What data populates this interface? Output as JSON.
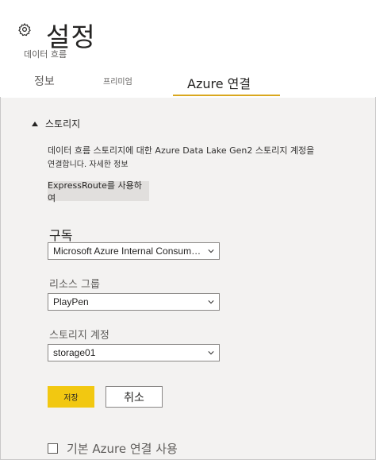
{
  "header": {
    "title": "설정",
    "subtitle": "데이터 흐름",
    "icon": "gear-icon"
  },
  "tabs": [
    {
      "label": "정보"
    },
    {
      "label": "프리미엄"
    },
    {
      "label": "Azure 연결",
      "selected": true
    }
  ],
  "accent_color": "#F2C811",
  "storage": {
    "section_title": "스토리지",
    "description_line1": "데이터 흐름 스토리지에 대한 Azure Data Lake Gen2 스토리지 계정을",
    "description_line2": "연결합니다.",
    "more_info_link": "자세한 정보",
    "expressroute_button": "ExpressRoute를 사용하여"
  },
  "form": {
    "subscription_label": "구독",
    "subscription_value": "Microsoft Azure Internal Consump...",
    "resource_group_label": "리소스 그룹",
    "resource_group_value": "PlayPen",
    "storage_account_label": "스토리지 계정",
    "storage_account_value": "storage01"
  },
  "actions": {
    "save": "저장",
    "cancel": "취소"
  },
  "default_connection": {
    "label": "기본 Azure 연결 사용",
    "checked": false
  }
}
